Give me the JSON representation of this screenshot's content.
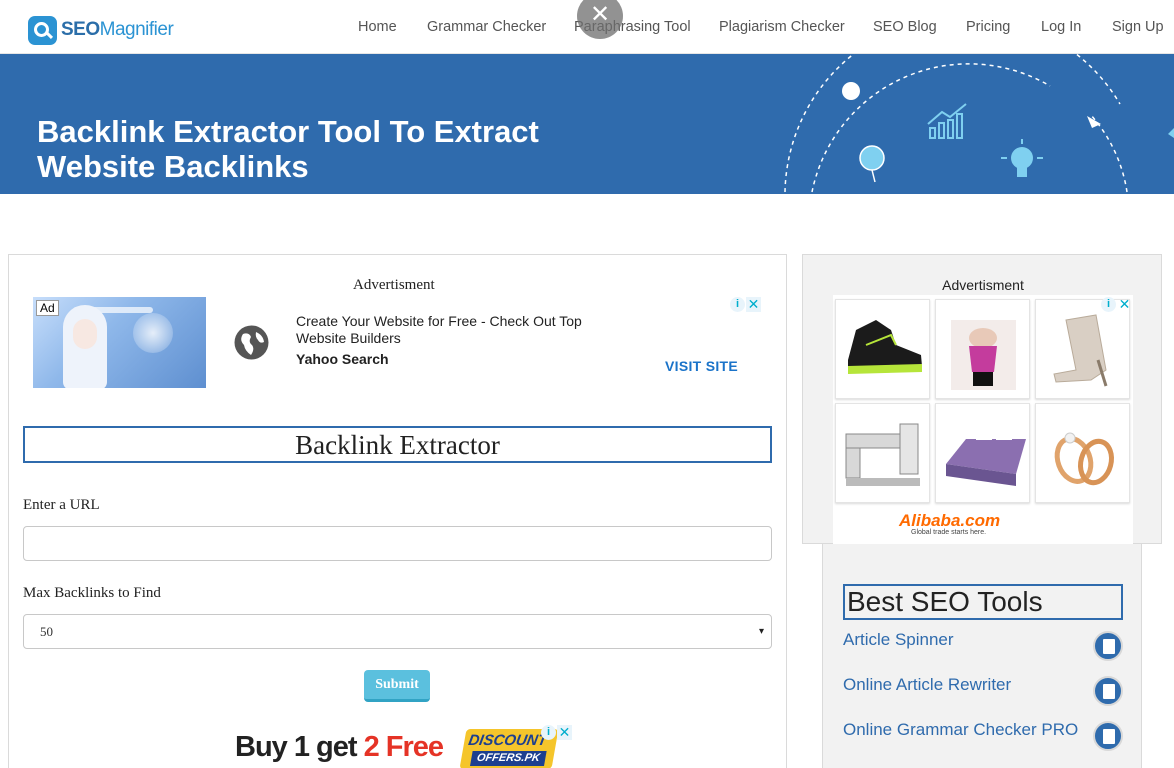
{
  "brand": {
    "name_part1": "SEO",
    "name_part2": "Magnifier"
  },
  "nav": {
    "items": [
      {
        "label": "Home"
      },
      {
        "label": "Grammar Checker"
      },
      {
        "label": "Paraphrasing Tool"
      },
      {
        "label": "Plagiarism Checker"
      },
      {
        "label": "SEO Blog"
      },
      {
        "label": "Pricing"
      },
      {
        "label": "Log In"
      },
      {
        "label": "Sign Up"
      }
    ],
    "close_glyph": "✕"
  },
  "hero": {
    "title": "Backlink Extractor Tool To Extract Website Backlinks"
  },
  "main_ad": {
    "caption": "Advertisment",
    "tag": "Ad",
    "text": "Create Your Website for Free - Check Out Top Website Builders",
    "source": "Yahoo Search",
    "cta": "VISIT SITE",
    "adchoice_i": "i",
    "adchoice_x": "✕"
  },
  "tool": {
    "title": "Backlink Extractor",
    "url_label": "Enter a URL",
    "url_value": "",
    "max_label": "Max Backlinks to Find",
    "max_value": "50",
    "caret": "▾",
    "submit_label": "Submit"
  },
  "promo": {
    "text_part1": "Buy 1 get ",
    "text_part2": "2 Free",
    "badge_line1": "DISCOUNT",
    "badge_line2": "OFFERS.PK"
  },
  "side_ad": {
    "caption": "Advertisment",
    "brand": "Alibaba.com",
    "tagline": "Global trade starts here.",
    "products": [
      "green-sneaker",
      "pink-corset",
      "heeled-sandal",
      "sewing-machine",
      "bedspread",
      "gold-rings"
    ]
  },
  "best_tools": {
    "title": "Best SEO Tools",
    "items": [
      {
        "label": "Article Spinner"
      },
      {
        "label": "Online Article Rewriter"
      },
      {
        "label": "Online Grammar Checker PRO"
      }
    ]
  },
  "colors": {
    "brand_blue": "#2f6bad",
    "submit": "#5bc0de",
    "link": "#2f6bad",
    "cta": "#1a73c9"
  }
}
